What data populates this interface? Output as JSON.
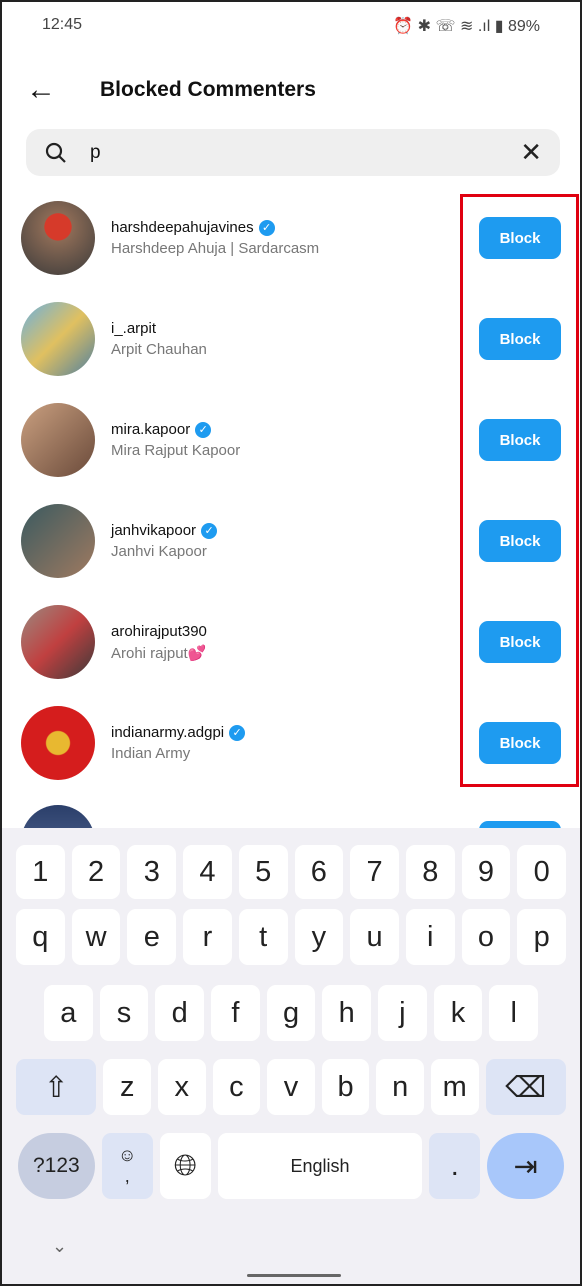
{
  "status": {
    "time": "12:45",
    "icons": [
      "alarm-icon",
      "bluetooth-icon",
      "wifi-call-icon",
      "wifi-icon",
      "signal-icon",
      "battery-icon"
    ],
    "battery": "89%"
  },
  "header": {
    "title": "Blocked Commenters"
  },
  "search": {
    "value": "p"
  },
  "accent": "#1e9bf0",
  "users": [
    {
      "username": "harshdeepahujavines",
      "name": "Harshdeep Ahuja | Sardarcasm",
      "verified": true,
      "button": "Block"
    },
    {
      "username": "i_.arpit",
      "name": "Arpit Chauhan",
      "verified": false,
      "button": "Block"
    },
    {
      "username": "mira.kapoor",
      "name": "Mira Rajput Kapoor",
      "verified": true,
      "button": "Block"
    },
    {
      "username": "janhvikapoor",
      "name": "Janhvi Kapoor",
      "verified": true,
      "button": "Block"
    },
    {
      "username": "arohirajput390",
      "name": "Arohi rajput💕",
      "verified": false,
      "button": "Block"
    },
    {
      "username": "indianarmy.adgpi",
      "name": "Indian Army",
      "verified": true,
      "button": "Block"
    }
  ],
  "keyboard": {
    "numbers": [
      "1",
      "2",
      "3",
      "4",
      "5",
      "6",
      "7",
      "8",
      "9",
      "0"
    ],
    "row1": [
      "q",
      "w",
      "e",
      "r",
      "t",
      "y",
      "u",
      "i",
      "o",
      "p"
    ],
    "row2": [
      "a",
      "s",
      "d",
      "f",
      "g",
      "h",
      "j",
      "k",
      "l"
    ],
    "row3": [
      "z",
      "x",
      "c",
      "v",
      "b",
      "n",
      "m"
    ],
    "symbols": "?123",
    "comma": ",",
    "space": "English",
    "period": "."
  }
}
